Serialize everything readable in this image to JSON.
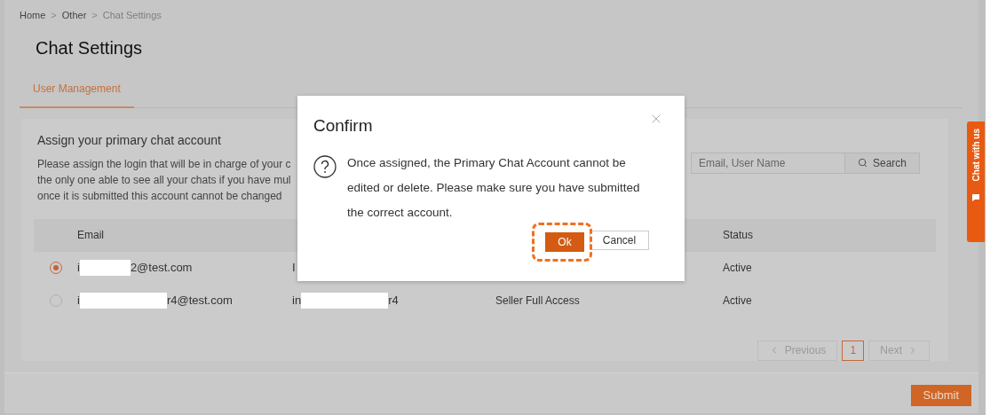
{
  "breadcrumb": [
    {
      "label": "Home",
      "current": false
    },
    {
      "label": "Other",
      "current": false
    },
    {
      "label": "Chat Settings",
      "current": true
    }
  ],
  "breadcrumb_separator": ">",
  "page_title": "Chat Settings",
  "tabs": [
    {
      "label": "User Management",
      "selected": true
    }
  ],
  "section": {
    "title": "Assign your primary chat account",
    "description_lines": [
      "Please assign the login that will be in charge of your c",
      "the only one able to see all your chats if you have mul",
      "once it is submitted this account cannot be changed"
    ]
  },
  "search": {
    "placeholder": "Email, User Name",
    "button": "Search"
  },
  "table": {
    "columns": [
      "Email",
      "Status"
    ],
    "rows": [
      {
        "selected": true,
        "email": {
          "start": "i",
          "end": "2@test.com"
        },
        "user": {
          "start": "I"
        },
        "status": "Active"
      },
      {
        "selected": false,
        "email": {
          "start": "i",
          "end": "r4@test.com"
        },
        "user": {
          "start": "in",
          "end": "r4"
        },
        "role": "Seller Full Access",
        "status": "Active"
      }
    ]
  },
  "pagination": {
    "previous": "Previous",
    "pages": [
      {
        "label": "1",
        "selected": true
      }
    ],
    "next": "Next"
  },
  "submit": "Submit",
  "chat_tab": "Chat with us",
  "dialog": {
    "title": "Confirm",
    "message": "Once assigned, the Primary Chat Account cannot be edited or delete. Please make sure you have submitted the correct account.",
    "ok": "Ok",
    "cancel": "Cancel",
    "ok_highlighted": true
  }
}
